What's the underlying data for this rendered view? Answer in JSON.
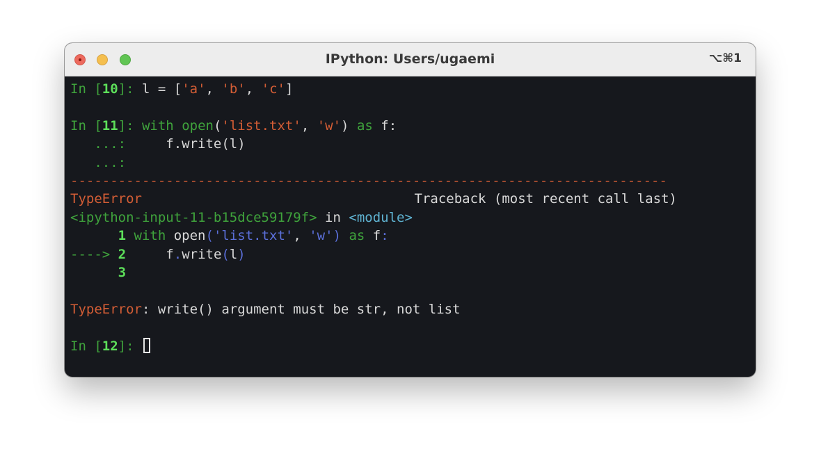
{
  "window": {
    "title": "IPython: Users/ugaemi",
    "shortcut": "⌥⌘1"
  },
  "terminal": {
    "l1": {
      "in": "In [",
      "num": "10",
      "close": "]: ",
      "code_a": "l = [",
      "s1": "'a'",
      "c1": ", ",
      "s2": "'b'",
      "c2": ", ",
      "s3": "'c'",
      "code_b": "]"
    },
    "l2": {
      "in": "In [",
      "num": "11",
      "close": "]: ",
      "kw_with": "with",
      "sp1": " ",
      "fn_open": "open",
      "p1": "(",
      "s1": "'list.txt'",
      "c1": ", ",
      "s2": "'w'",
      "p2": ")",
      "sp2": " ",
      "kw_as": "as",
      "tail": " f:"
    },
    "l3": {
      "cont": "   ...: ",
      "code": "    f.write(l)"
    },
    "l4": {
      "cont": "   ...:"
    },
    "separator": "---------------------------------------------------------------------------",
    "l5": {
      "exc": "TypeError",
      "tb": "Traceback (most recent call last)"
    },
    "l6": {
      "file": "<ipython-input-11-b15dce59179f>",
      "in": " in ",
      "module": "<module>"
    },
    "l7": {
      "num": "      1 ",
      "kw_with": "with",
      "sp": " ",
      "fn_open": "open",
      "p1": "(",
      "s1": "'list.txt'",
      "c1": ", ",
      "s2": "'w'",
      "p2": ")",
      "sp2": " ",
      "kw_as": "as",
      "f": " f",
      "colon": ":"
    },
    "l8": {
      "arrow": "----> ",
      "num": "2",
      "code_a": "     f",
      "dot": ".",
      "code_b": "write",
      "p1": "(",
      "arg": "l",
      "p2": ")"
    },
    "l9": {
      "num": "      3"
    },
    "l10": {
      "exc": "TypeError",
      "msg": ": write() argument must be str, not list"
    },
    "l11": {
      "in": "In [",
      "num": "12",
      "close": "]: "
    }
  }
}
